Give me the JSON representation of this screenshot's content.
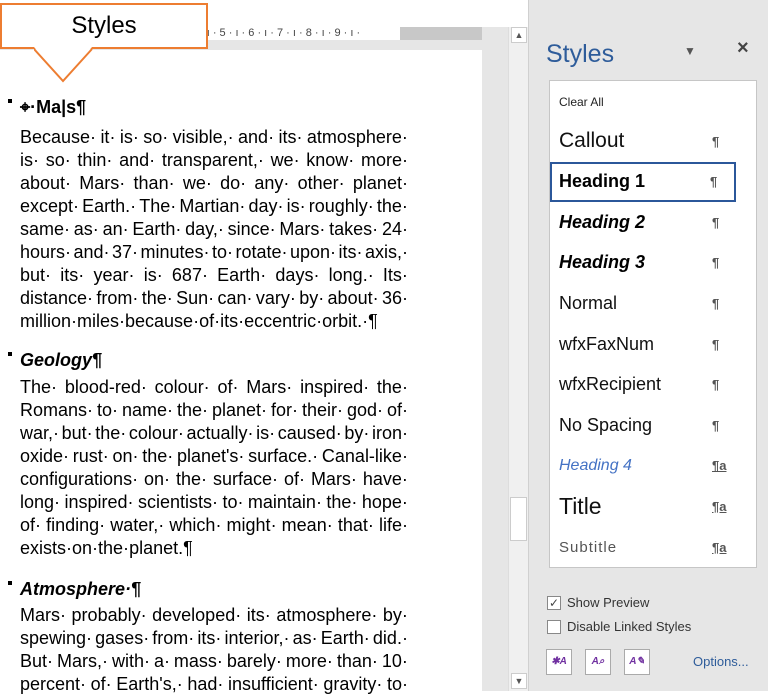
{
  "callout": {
    "label": "Styles",
    "border_color": "#ed7d31"
  },
  "ruler": {
    "text": "· ı · 5 · ı · 6 · ı · 7 · ı · 8 · ı · 9 · ı ·"
  },
  "document": {
    "sections": [
      {
        "heading": "⌖·Ma|s¶",
        "italic": false,
        "lines": [
          "Because·it·is·so·visible,·and·its·atmosphere·",
          "is·so·thin·and·transparent,·we·know·more·",
          "about·Mars·than·we·do·any·other·planet·",
          "except·Earth.·The·Martian·day·is·roughly·the·",
          "same·as·an·Earth·day,·since·Mars·takes·24·",
          "hours·and·37·minutes·to·rotate·upon·its·axis,·",
          "but·its·year·is·687·Earth·days·long.·Its·",
          "distance·from·the·Sun·can·vary·by·about·36·",
          "million·miles·because·of·its·eccentric·orbit.·¶"
        ]
      },
      {
        "heading": "Geology¶",
        "italic": true,
        "lines": [
          "The·blood-red·colour·of·Mars·inspired·the·",
          "Romans·to·name·the·planet·for·their·god·of·",
          "war,·but·the·colour·actually·is·caused·by·iron·",
          "oxide·rust·on·the·planet's·surface.·Canal-like·",
          "configurations·on·the·surface·of·Mars·have·",
          "long·inspired·scientists·to·maintain·the·hope·",
          "of·finding·water,·which·might·mean·that·life·",
          "exists·on·the·planet.¶"
        ]
      },
      {
        "heading": "Atmosphere·¶",
        "italic": true,
        "lines": [
          "Mars·probably·developed·its·atmosphere·by·",
          "spewing·gases·from·its·interior,·as·Earth·did.·",
          "But·Mars,·with·a·mass·barely·more·than·10·",
          "percent·of·Earth's,·had·insufficient·gravity·to·"
        ]
      }
    ]
  },
  "panel": {
    "title": "Styles",
    "menu_icon": "triangle-down",
    "close_icon": "×",
    "clear_all": "Clear All",
    "styles": [
      {
        "name": "Callout",
        "mark": "¶",
        "selected": false
      },
      {
        "name": "Heading 1",
        "mark": "¶",
        "selected": true
      },
      {
        "name": "Heading 2",
        "mark": "¶",
        "selected": false
      },
      {
        "name": "Heading 3",
        "mark": "¶",
        "selected": false
      },
      {
        "name": "Normal",
        "mark": "¶",
        "selected": false
      },
      {
        "name": "wfxFaxNum",
        "mark": "¶",
        "selected": false
      },
      {
        "name": "wfxRecipient",
        "mark": "¶",
        "selected": false
      },
      {
        "name": "No Spacing",
        "mark": "¶",
        "selected": false
      },
      {
        "name": "Heading 4",
        "mark": "¶a",
        "selected": false
      },
      {
        "name": "Title",
        "mark": "¶a",
        "selected": false
      },
      {
        "name": "Subtitle",
        "mark": "¶a",
        "selected": false
      }
    ],
    "show_preview": {
      "label": "Show Preview",
      "checked": true
    },
    "disable_linked": {
      "label": "Disable Linked Styles",
      "checked": false
    },
    "buttons": [
      "new-style",
      "style-inspector",
      "manage-styles"
    ],
    "options_label": "Options...",
    "accent": "#2b579a"
  }
}
